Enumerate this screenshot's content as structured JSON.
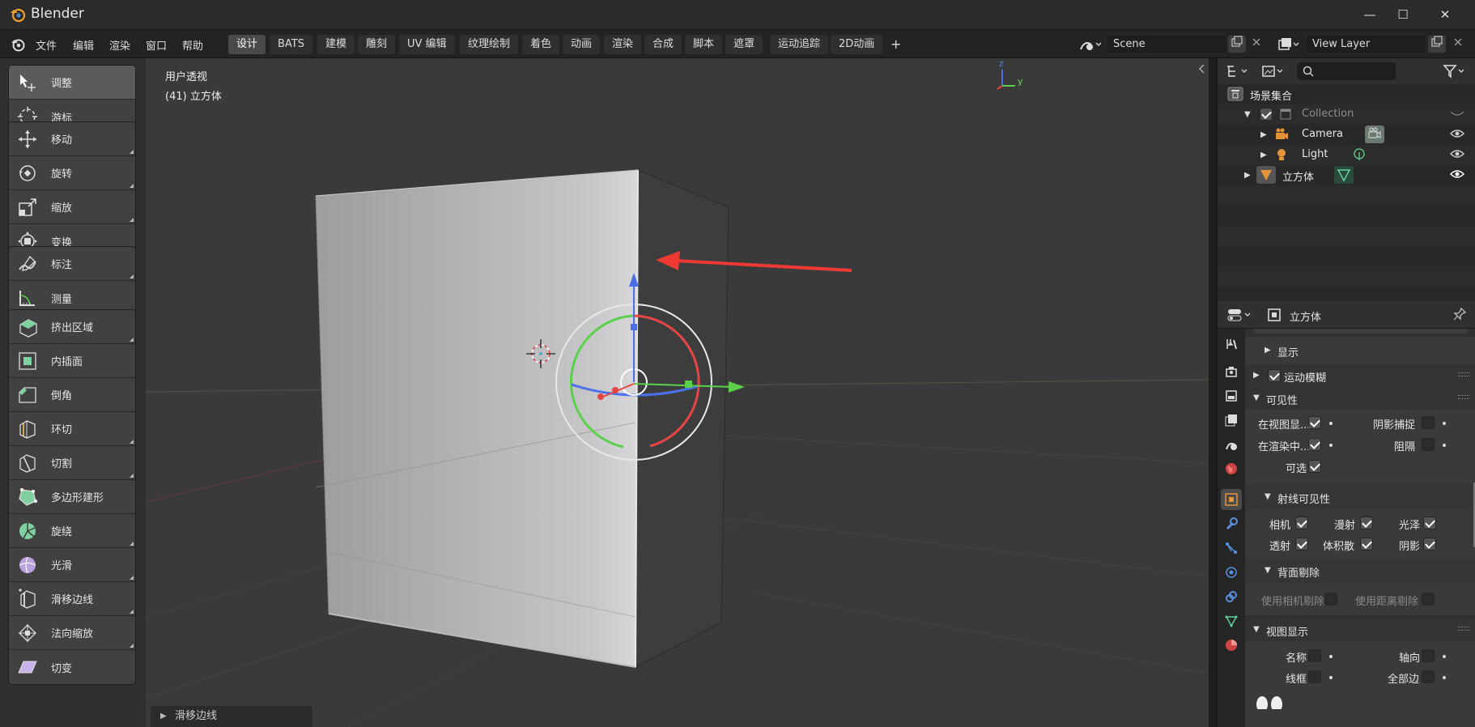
{
  "window": {
    "app_title": "Blender",
    "minimize": "—",
    "maximize": "☐",
    "close": "✕"
  },
  "menubar": {
    "items": [
      "文件",
      "编辑",
      "渲染",
      "窗口",
      "帮助"
    ]
  },
  "workspaces": {
    "tabs": [
      "设计",
      "BATS",
      "建模",
      "雕刻",
      "UV 编辑",
      "纹理绘制",
      "着色",
      "动画",
      "渲染",
      "合成",
      "脚本",
      "遮罩",
      "运动追踪",
      "2D动画"
    ],
    "add": "+",
    "active": "设计"
  },
  "scene": {
    "name": "Scene"
  },
  "view_layer": {
    "name": "View Layer"
  },
  "toolbar": {
    "tools": [
      "调整",
      "游标",
      "移动",
      "旋转",
      "缩放",
      "变换",
      "标注",
      "测量",
      "挤出区域",
      "内插面",
      "倒角",
      "环切",
      "切割",
      "多边形建形",
      "旋绕",
      "光滑",
      "滑移边线",
      "法向缩放",
      "切变"
    ]
  },
  "viewport": {
    "hud_view": "用户透视",
    "hud_object": "(41) 立方体",
    "last_operator": "滑移边线",
    "axis_labels": {
      "z": "z",
      "y": "y"
    }
  },
  "outliner": {
    "scene_collection": "场景集合",
    "collection": "Collection",
    "camera": "Camera",
    "light": "Light",
    "cube": "立方体"
  },
  "properties": {
    "object_name": "立方体",
    "sections": {
      "display": "显示",
      "motion_blur": "运动模糊",
      "visibility": "可见性",
      "ray_visibility": "射线可见性",
      "backface_culling": "背面剔除",
      "viewport_display": "视图显示"
    },
    "visibility": {
      "in_viewport": "在视图显...",
      "shadow_catcher": "阴影捕捉",
      "in_render": "在渲染中...",
      "holdout": "阻隔",
      "selectable": "可选"
    },
    "ray": {
      "camera": "相机",
      "diffuse": "漫射",
      "glossy": "光泽",
      "transmission": "透射",
      "volume_scatter": "体积散",
      "shadow": "阴影"
    },
    "culling": {
      "use_camera": "使用相机剔除",
      "use_distance": "使用距离剔除"
    },
    "viewport_display": {
      "name": "名称",
      "axis": "轴向",
      "wireframe": "线框",
      "all_edges": "全部边"
    }
  },
  "colors": {
    "accent_blue": "#4772b3",
    "axis_x": "#e64545",
    "axis_y": "#5bd04a",
    "axis_z": "#4a6fe8",
    "arrow": "#ee3a33"
  }
}
